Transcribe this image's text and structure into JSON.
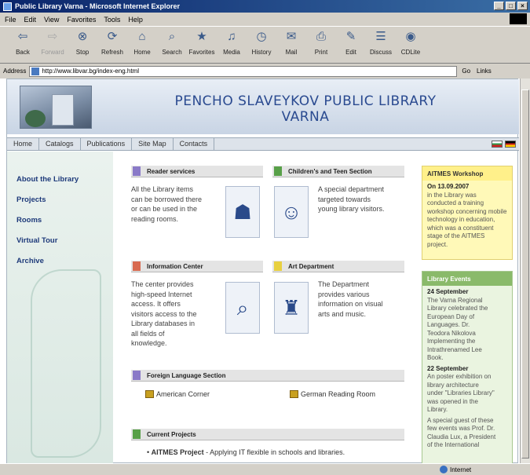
{
  "window": {
    "title": "Public Library Varna - Microsoft Internet Explorer",
    "controls": [
      "_",
      "□",
      "×"
    ]
  },
  "menu": [
    "File",
    "Edit",
    "View",
    "Favorites",
    "Tools",
    "Help"
  ],
  "toolbar": [
    {
      "label": "Back",
      "icon": "back-arrow-icon",
      "glyph": "⇦",
      "enabled": true
    },
    {
      "label": "Forward",
      "icon": "forward-arrow-icon",
      "glyph": "⇨",
      "enabled": false
    },
    {
      "label": "Stop",
      "icon": "stop-icon",
      "glyph": "⊗",
      "enabled": true
    },
    {
      "label": "Refresh",
      "icon": "refresh-icon",
      "glyph": "⟳",
      "enabled": true
    },
    {
      "label": "Home",
      "icon": "home-icon",
      "glyph": "⌂",
      "enabled": true
    },
    {
      "label": "Search",
      "icon": "search-icon",
      "glyph": "⌕",
      "enabled": true
    },
    {
      "label": "Favorites",
      "icon": "favorites-icon",
      "glyph": "★",
      "enabled": true
    },
    {
      "label": "Media",
      "icon": "media-icon",
      "glyph": "♫",
      "enabled": true
    },
    {
      "label": "History",
      "icon": "history-icon",
      "glyph": "◷",
      "enabled": true
    },
    {
      "label": "Mail",
      "icon": "mail-icon",
      "glyph": "✉",
      "enabled": true
    },
    {
      "label": "Print",
      "icon": "print-icon",
      "glyph": "⎙",
      "enabled": true
    },
    {
      "label": "Edit",
      "icon": "edit-icon",
      "glyph": "✎",
      "enabled": true
    },
    {
      "label": "Discuss",
      "icon": "discuss-icon",
      "glyph": "☰",
      "enabled": true
    },
    {
      "label": "CDLite",
      "icon": "cdlite-icon",
      "glyph": "◉",
      "enabled": true
    }
  ],
  "address": {
    "label": "Address",
    "url": "http://www.libvar.bg/index-eng.html",
    "go": "Go",
    "links": "Links"
  },
  "site": {
    "title_line1": "PENCHO SLAVEYKOV PUBLIC LIBRARY",
    "title_line2": "VARNA",
    "nav": [
      "Home",
      "Catalogs",
      "Publications",
      "Site Map",
      "Contacts"
    ],
    "sidebar": [
      "About the Library",
      "Projects",
      "Rooms",
      "Virtual Tour",
      "Archive"
    ],
    "sections": {
      "reader": {
        "title": "Reader services",
        "color": "#8a7ac8",
        "text": [
          "All the Library items",
          "can be borrowed there",
          "or can be used in the",
          "reading rooms."
        ],
        "icon": "reader-icon",
        "glyph": "☗"
      },
      "children": {
        "title": "Children's and Teen Section",
        "color": "#58a048",
        "text": [
          "A special department",
          "targeted towards",
          "young library visitors."
        ],
        "icon": "children-icon",
        "glyph": "☺"
      },
      "info": {
        "title": "Information Center",
        "color": "#d86a50",
        "text": [
          "The center provides",
          "high-speed Internet",
          "access. It offers",
          "visitors access to the",
          "Library databases in",
          "all fields of",
          "knowledge."
        ],
        "icon": "information-icon",
        "glyph": "⌕"
      },
      "art": {
        "title": "Art Department",
        "color": "#e8d040",
        "text": [
          "The Department",
          "provides various",
          "information on visual",
          "arts and music."
        ],
        "icon": "art-icon",
        "glyph": "♜"
      },
      "foreign": {
        "title": "Foreign Language Section",
        "color": "#8a7ac8",
        "american": "American Corner",
        "german": "German Reading Room"
      },
      "current": {
        "title": "Current Projects",
        "color": "#58a048",
        "project": "AITMES Project",
        "project_desc": " - Applying IT flexible in schools and libraries."
      }
    },
    "workshop": {
      "title": "AITMES Workshop",
      "date": "On 13.09.2007",
      "text": [
        "in the Library was",
        "conducted a training",
        "workshop concerning mobile",
        "technology in education,",
        "which was a constituent",
        "stage of the AITMES",
        "project."
      ]
    },
    "events": {
      "title": "Library Events",
      "items": [
        {
          "date": "24 September",
          "text": [
            "The Varna Regional",
            "Library celebrated the",
            "European Day of",
            "Languages. Dr.",
            "Teodora Nikolova",
            "Implementing the",
            "Intrathrenamed Lee",
            "Book."
          ]
        },
        {
          "date": "22 September",
          "text": [
            "An poster exhibition on",
            "library architecture",
            "under \"Libraries Library\"",
            "was opened in the",
            "Library."
          ]
        },
        {
          "date": "",
          "text": [
            "A special guest of these",
            "few events was Prof. Dr.",
            "Claudia Lux, a President",
            "of the International"
          ]
        }
      ]
    }
  },
  "status": {
    "zone": "Internet"
  }
}
